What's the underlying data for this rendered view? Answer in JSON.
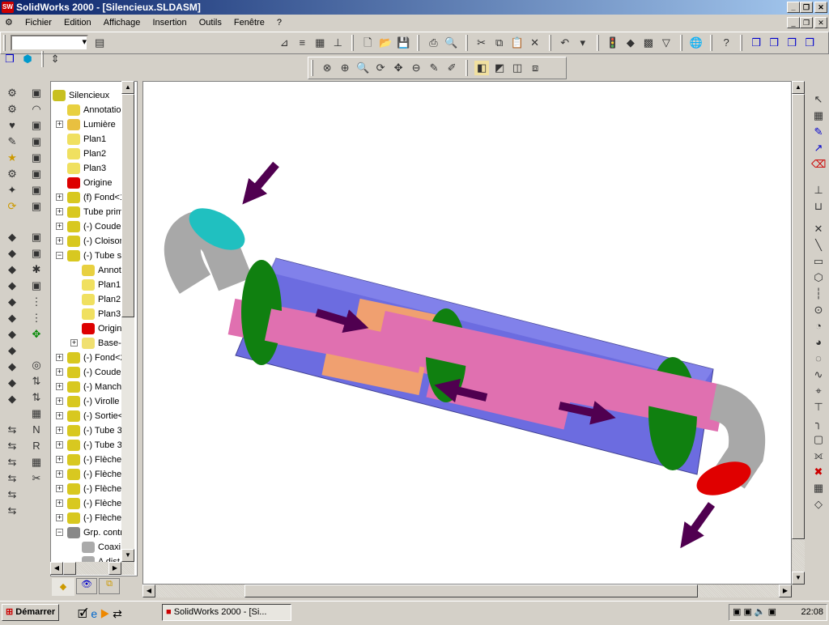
{
  "window": {
    "title": "SolidWorks 2000 - [Silencieux.SLDASM]",
    "app_icon": "SW"
  },
  "menu": [
    "Fichier",
    "Edition",
    "Affichage",
    "Insertion",
    "Outils",
    "Fenêtre",
    "?"
  ],
  "tree": {
    "root": "Silencieux",
    "items": [
      {
        "label": "Annotatio",
        "icon": "annotation",
        "level": 1,
        "exp": ""
      },
      {
        "label": "Lumière",
        "icon": "light",
        "level": 1,
        "exp": "+"
      },
      {
        "label": "Plan1",
        "icon": "plane",
        "level": 1,
        "exp": ""
      },
      {
        "label": "Plan2",
        "icon": "plane",
        "level": 1,
        "exp": ""
      },
      {
        "label": "Plan3",
        "icon": "plane",
        "level": 1,
        "exp": ""
      },
      {
        "label": "Origine",
        "icon": "origin",
        "level": 1,
        "exp": ""
      },
      {
        "label": "(f) Fond<1",
        "icon": "part",
        "level": 1,
        "exp": "+"
      },
      {
        "label": "Tube prim",
        "icon": "part",
        "level": 1,
        "exp": "+"
      },
      {
        "label": "(-) Coude",
        "icon": "part",
        "level": 1,
        "exp": "+"
      },
      {
        "label": "(-) Cloison",
        "icon": "part",
        "level": 1,
        "exp": "+"
      },
      {
        "label": "(-) Tube s",
        "icon": "part",
        "level": 1,
        "exp": "-"
      },
      {
        "label": "Annot",
        "icon": "annotation",
        "level": 2,
        "exp": ""
      },
      {
        "label": "Plan1",
        "icon": "plane",
        "level": 2,
        "exp": ""
      },
      {
        "label": "Plan2",
        "icon": "plane",
        "level": 2,
        "exp": ""
      },
      {
        "label": "Plan3",
        "icon": "plane",
        "level": 2,
        "exp": ""
      },
      {
        "label": "Origin",
        "icon": "origin",
        "level": 2,
        "exp": ""
      },
      {
        "label": "Base-",
        "icon": "feature",
        "level": 2,
        "exp": "+"
      },
      {
        "label": "(-) Fond<2",
        "icon": "part",
        "level": 1,
        "exp": "+"
      },
      {
        "label": "(-) Coude",
        "icon": "part",
        "level": 1,
        "exp": "+"
      },
      {
        "label": "(-) Manch",
        "icon": "part",
        "level": 1,
        "exp": "+"
      },
      {
        "label": "(-) Virolle E",
        "icon": "part",
        "level": 1,
        "exp": "+"
      },
      {
        "label": "(-) Sortie<",
        "icon": "part",
        "level": 1,
        "exp": "+"
      },
      {
        "label": "(-) Tube 3",
        "icon": "part",
        "level": 1,
        "exp": "+"
      },
      {
        "label": "(-) Tube 3",
        "icon": "part",
        "level": 1,
        "exp": "+"
      },
      {
        "label": "(-) Flèche-",
        "icon": "part",
        "level": 1,
        "exp": "+"
      },
      {
        "label": "(-) Flèche-",
        "icon": "part",
        "level": 1,
        "exp": "+"
      },
      {
        "label": "(-) Flèche-",
        "icon": "part",
        "level": 1,
        "exp": "+"
      },
      {
        "label": "(-) Flèche-",
        "icon": "part",
        "level": 1,
        "exp": "+"
      },
      {
        "label": "(-) Flèche-",
        "icon": "part",
        "level": 1,
        "exp": "+"
      },
      {
        "label": "Grp. contr",
        "icon": "mates",
        "level": 1,
        "exp": "-"
      },
      {
        "label": "Coaxi",
        "icon": "mate",
        "level": 2,
        "exp": ""
      },
      {
        "label": "A dist",
        "icon": "mate",
        "level": 2,
        "exp": ""
      }
    ]
  },
  "taskbar": {
    "start": "Démarrer",
    "task": "SolidWorks 2000 - [Si...",
    "clock": "22:08"
  },
  "colors": {
    "body": "#7070e0",
    "tube": "#e070b0",
    "inner": "#f0a070",
    "baffle": "#108010",
    "elbow": "#b0b0b0",
    "inlet": "#20c0c0",
    "outlet": "#e00000",
    "arrow": "#500050"
  }
}
